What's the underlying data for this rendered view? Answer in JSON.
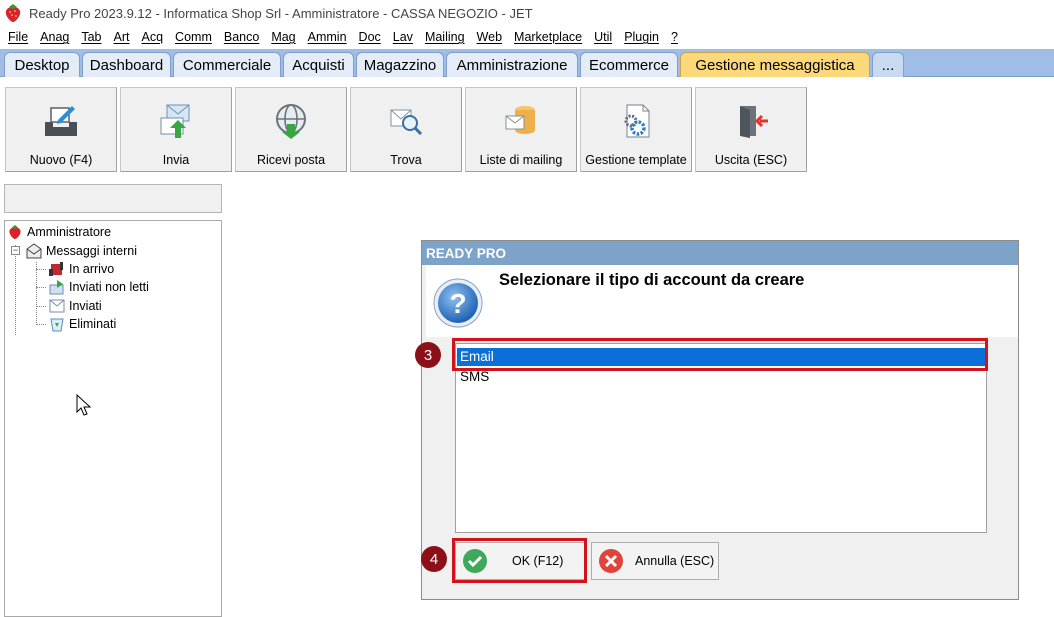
{
  "window": {
    "title": "Ready Pro 2023.9.12 - Informatica Shop Srl - Amministratore - CASSA NEGOZIO - JET",
    "app_icon": "strawberry-icon"
  },
  "menu": [
    "File",
    "Anag",
    "Tab",
    "Art",
    "Acq",
    "Comm",
    "Banco",
    "Mag",
    "Ammin",
    "Doc",
    "Lav",
    "Mailing",
    "Web",
    "Marketplace",
    "Util",
    "Plugin",
    "?"
  ],
  "tabs": [
    {
      "label": "Desktop",
      "active": false
    },
    {
      "label": "Dashboard",
      "active": false
    },
    {
      "label": "Commerciale",
      "active": false
    },
    {
      "label": "Acquisti",
      "active": false
    },
    {
      "label": "Magazzino",
      "active": false
    },
    {
      "label": "Amministrazione",
      "active": false
    },
    {
      "label": "Ecommerce",
      "active": false
    },
    {
      "label": "Gestione messaggistica",
      "active": true
    },
    {
      "label": "...",
      "active": false
    }
  ],
  "toolbar": {
    "buttons": [
      {
        "label": "Nuovo (F4)",
        "icon": "new-message-icon"
      },
      {
        "label": "Invia",
        "icon": "send-icon"
      },
      {
        "label": "Ricevi posta",
        "icon": "receive-mail-icon"
      },
      {
        "label": "Trova",
        "icon": "find-icon"
      },
      {
        "label": "Liste di mailing",
        "icon": "mailing-list-icon"
      },
      {
        "label": "Gestione template",
        "icon": "template-settings-icon"
      },
      {
        "label": "Uscita (ESC)",
        "icon": "exit-icon"
      }
    ]
  },
  "tree": {
    "root": "Amministratore",
    "group": "Messaggi interni",
    "items": [
      "In arrivo",
      "Inviati non letti",
      "Inviati",
      "Eliminati"
    ]
  },
  "dialog": {
    "title": "READY PRO",
    "message": "Selezionare il tipo di account da creare",
    "options": [
      {
        "label": "Email",
        "selected": true
      },
      {
        "label": "SMS",
        "selected": false
      }
    ],
    "ok_label": "OK (F12)",
    "cancel_label": "Annulla (ESC)"
  },
  "annotations": {
    "step3": "3",
    "step4": "4",
    "color": "#d4121c"
  },
  "colors": {
    "tab_strip": "#9fbde5",
    "active_tab": "#fbd87a",
    "dialog_title": "#7ea3c9",
    "selection": "#0a6fd7"
  }
}
